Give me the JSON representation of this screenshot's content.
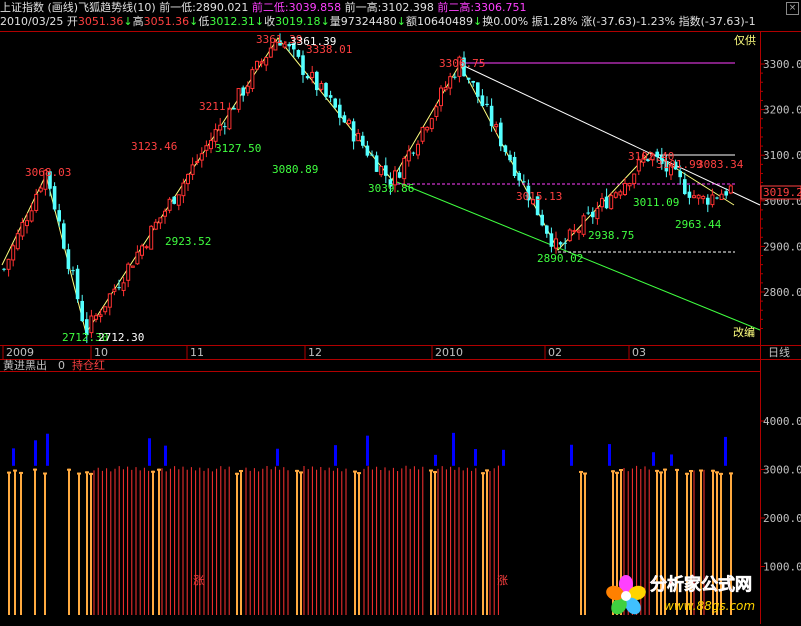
{
  "header": {
    "index_name": "上证指数",
    "mode": "(画线)",
    "indicator": "飞狐趋势线(10)",
    "prev_low_label": "前一低:",
    "prev_low": "2890.021",
    "prev2_low_label": "前二低:",
    "prev2_low": "3039.858",
    "prev_high_label": "前一高:",
    "prev_high": "3102.398",
    "prev2_high_label": "前二高:",
    "prev2_high": "3306.751",
    "close_btn": "×",
    "date": "2010/03/25",
    "open_label": "开",
    "open": "3051.36",
    "high_label": "高",
    "high": "3051.36",
    "low_label": "低",
    "low": "3012.31",
    "close_label": "收",
    "close": "3019.18",
    "vol_label": "量",
    "vol": "97324480",
    "amount_label": "额",
    "amount": "10640489",
    "turnover_label": "换",
    "turnover": "0.00%",
    "amp_label": "振",
    "amp": "1.28%",
    "chg_label": "涨",
    "chg": "(-37.63)-1.23%",
    "idx_label": "指数",
    "idx": "(-37.63)-1"
  },
  "colors": {
    "up": "#ff3232",
    "down": "#54ffff",
    "high_label": "#ff4040",
    "low_label": "#40ff40",
    "yellow": "#ffff7f",
    "magenta": "#ff40ff",
    "blue": "#0000ff",
    "orange": "#ffaa40",
    "axis": "#b00000"
  },
  "texts": {
    "top_right_note": "仅供",
    "bottom_right_note": "改编",
    "period": "日线",
    "price_tag": "3019.2",
    "indicator_name": "黄进黑出",
    "indicator_value": "0",
    "indicator_label": "持仓红",
    "rise_char": "涨",
    "watermark_cn": "分析家公式网",
    "watermark_url": "www.88gs.com"
  },
  "chart_data": [
    {
      "type": "candlestick",
      "y_ticks": [
        "3300.00",
        "3200.00",
        "3100.00",
        "3000.00",
        "2900.00",
        "2800.00"
      ],
      "y_tick_values": [
        3300,
        3200,
        3100,
        3000,
        2900,
        2800
      ],
      "ylim": [
        2700,
        3365
      ],
      "x_labels": [
        "2009",
        "10",
        "11",
        "12",
        "2010",
        "02",
        "03"
      ],
      "swing_points": [
        {
          "label": "3068.03",
          "kind": "high",
          "value": 3068.03
        },
        {
          "label": "2712.30",
          "kind": "low",
          "value": 2712.3
        },
        {
          "label": "2712.30",
          "kind": "low_alt",
          "value": 2712.3
        },
        {
          "label": "3123.46",
          "kind": "high",
          "value": 3123.46
        },
        {
          "label": "2923.52",
          "kind": "low",
          "value": 2923.52
        },
        {
          "label": "3211.",
          "kind": "high",
          "value": 3211
        },
        {
          "label": "3127.50",
          "kind": "low",
          "value": 3127.5
        },
        {
          "label": "3361.39",
          "kind": "high",
          "value": 3361.39
        },
        {
          "label": "3361.39",
          "kind": "high_alt",
          "value": 3361.39
        },
        {
          "label": "3080.89",
          "kind": "low",
          "value": 3080.89
        },
        {
          "label": "3338.01",
          "kind": "high",
          "value": 3338.01
        },
        {
          "label": "3039.86",
          "kind": "low",
          "value": 3039.86
        },
        {
          "label": "3306.75",
          "kind": "high",
          "value": 3306.75
        },
        {
          "label": "3015.13",
          "kind": "high",
          "value": 3015.13
        },
        {
          "label": "2890.02",
          "kind": "low",
          "value": 2890.02
        },
        {
          "label": "2938.75",
          "kind": "low",
          "value": 2938.75
        },
        {
          "label": "3102.40",
          "kind": "high",
          "value": 3102.4
        },
        {
          "label": "3011.09",
          "kind": "low",
          "value": 3011.09
        },
        {
          "label": "3101.99",
          "kind": "high",
          "value": 3101.99
        },
        {
          "label": "3083.34",
          "kind": "high",
          "value": 3083.34
        },
        {
          "label": "2963.44",
          "kind": "low",
          "value": 2963.44
        }
      ]
    },
    {
      "type": "bar",
      "title": "黄进黑出",
      "y_ticks": [
        "4000.00",
        "3000.00",
        "2000.00",
        "1000.00"
      ],
      "y_tick_values": [
        4000,
        3000,
        2000,
        1000
      ],
      "ylim": [
        0,
        4400
      ]
    }
  ]
}
